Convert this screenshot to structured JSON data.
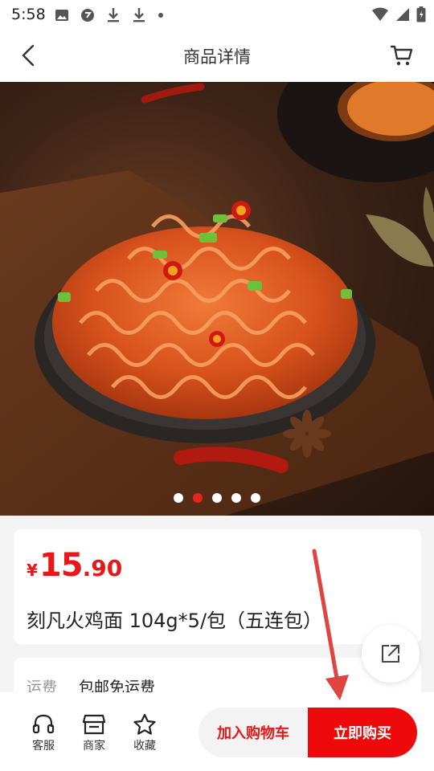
{
  "status_bar": {
    "time": "5:58"
  },
  "header": {
    "title": "商品详情"
  },
  "carousel": {
    "slide_count": 5,
    "active_index": 1
  },
  "product": {
    "currency": "¥",
    "price_int": "15",
    "price_dec": ".90",
    "name": "刻凡火鸡面 104g*5/包（五连包）"
  },
  "shipping": {
    "label": "运费",
    "value": "包邮免运费"
  },
  "bottom_bar": {
    "tabs": [
      {
        "label": "客服",
        "icon": "headset-icon"
      },
      {
        "label": "商家",
        "icon": "store-icon"
      },
      {
        "label": "收藏",
        "icon": "star-icon"
      }
    ],
    "add_to_cart": "加入购物车",
    "buy_now": "立即购买"
  },
  "colors": {
    "accent": "#ee0a0a",
    "price": "#e81818",
    "annotation_arrow": "#e0443e"
  }
}
